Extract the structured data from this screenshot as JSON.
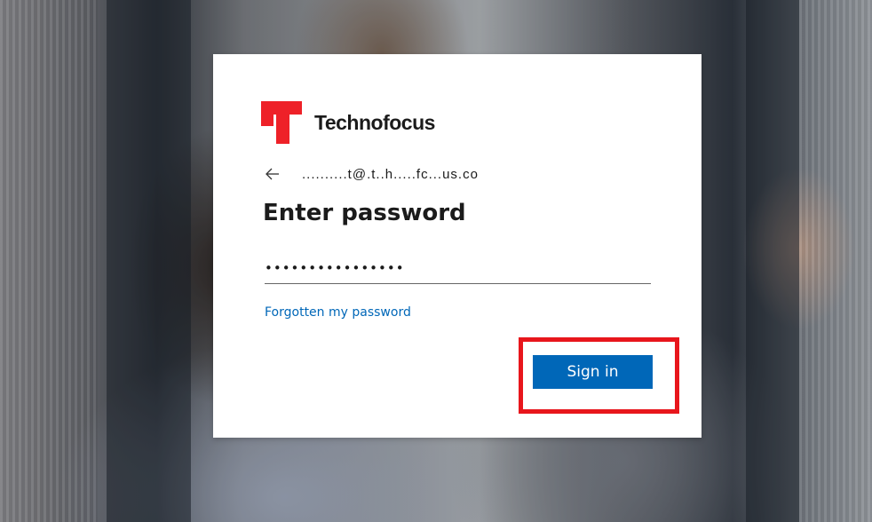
{
  "colors": {
    "brand_red": "#ee2128",
    "primary_button": "#0067b8",
    "link": "#0067b8",
    "highlight_border": "#e8161c",
    "text": "#1b1b1b"
  },
  "brand": {
    "name": "Technofocus",
    "logo_icon": "technofocus-logo-icon"
  },
  "identity": {
    "back_icon": "arrow-left-icon",
    "email": "..........t@.t..h.....fc...us.co"
  },
  "page": {
    "title": "Enter password"
  },
  "password": {
    "value": "••••••••••••••••"
  },
  "links": {
    "forgot_password": "Forgotten my password"
  },
  "actions": {
    "sign_in_label": "Sign in"
  }
}
